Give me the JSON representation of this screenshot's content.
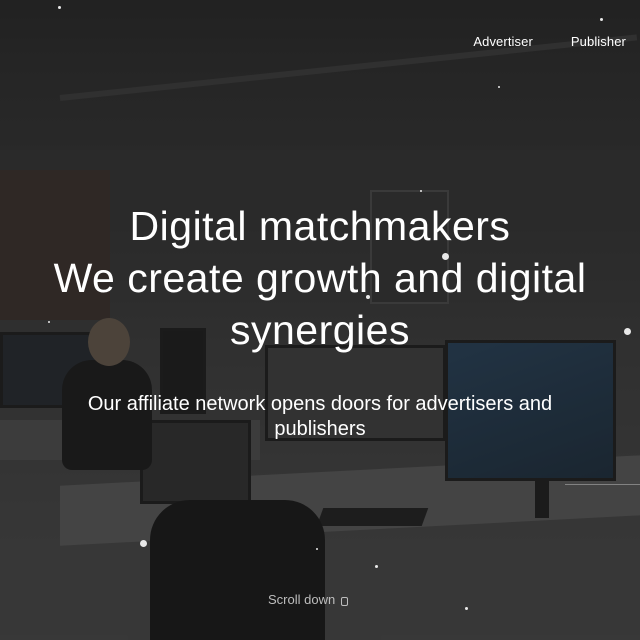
{
  "nav": {
    "advertiser": "Advertiser",
    "publisher": "Publisher"
  },
  "hero": {
    "headline_line1": "Digital matchmakers",
    "headline_line2": "We create growth and digital",
    "headline_line3": "synergies",
    "subline_line1": "Our affiliate network opens doors for advertisers and",
    "subline_line2": "publishers",
    "scroll_label": "Scroll down",
    "scroll_icon": "mouse-icon"
  },
  "colors": {
    "text": "#ffffff",
    "scroll_text": "#bdbdbd",
    "overlay": "#141414"
  }
}
